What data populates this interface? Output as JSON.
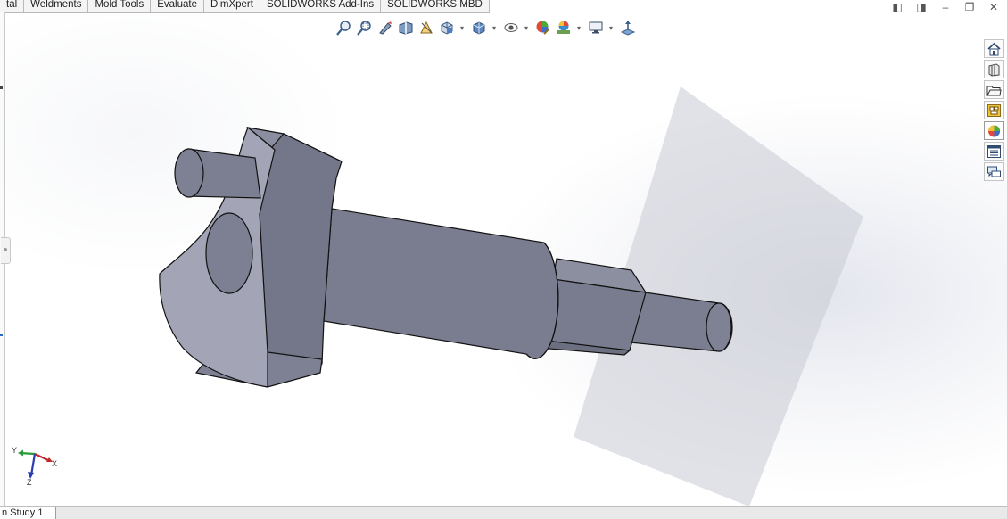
{
  "command_tabs": [
    "tal",
    "Weldments",
    "Mold Tools",
    "Evaluate",
    "DimXpert",
    "SOLIDWORKS Add-Ins",
    "SOLIDWORKS MBD"
  ],
  "heads_up_toolbar": [
    {
      "icon": "zoom-to-fit-icon"
    },
    {
      "icon": "zoom-to-area-icon"
    },
    {
      "icon": "previous-view-icon"
    },
    {
      "icon": "section-view-icon"
    },
    {
      "icon": "dynamic-annotation-views-icon"
    },
    {
      "icon": "view-orientation-icon",
      "dropdown": true
    },
    {
      "icon": "display-style-icon",
      "dropdown": true
    },
    {
      "icon": "hide-show-items-icon",
      "dropdown": true
    },
    {
      "icon": "edit-appearance-icon"
    },
    {
      "icon": "apply-scene-icon",
      "dropdown": true
    },
    {
      "icon": "view-settings-icon",
      "dropdown": true
    },
    {
      "icon": "rotate-view-icon"
    }
  ],
  "window_controls": [
    {
      "icon": "tile-left-icon",
      "glyph": "◧"
    },
    {
      "icon": "tile-right-icon",
      "glyph": "◨"
    },
    {
      "icon": "minimize-icon",
      "glyph": "–"
    },
    {
      "icon": "restore-icon",
      "glyph": "❐"
    },
    {
      "icon": "close-icon",
      "glyph": "✕"
    }
  ],
  "task_pane": [
    {
      "icon": "solidworks-resources-icon"
    },
    {
      "icon": "design-library-icon"
    },
    {
      "icon": "file-explorer-icon"
    },
    {
      "icon": "view-palette-icon"
    },
    {
      "icon": "appearances-scenes-decals-icon"
    },
    {
      "icon": "custom-properties-icon"
    },
    {
      "icon": "solidworks-forum-icon"
    }
  ],
  "triad": {
    "x": "X",
    "y": "Y",
    "z": "Z"
  },
  "bottom_tab": "n Study 1",
  "colors": {
    "part": "#7a7d8f",
    "part_light": "#a2a4b6",
    "part_dark": "#6b6e80",
    "edge": "#111111",
    "plane": "#c9cbd3"
  }
}
